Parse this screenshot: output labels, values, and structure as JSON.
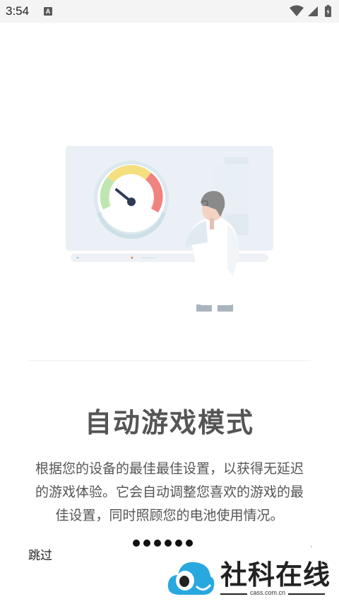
{
  "status_bar": {
    "time": "3:54",
    "notification_icon": "A"
  },
  "onboarding": {
    "title": "自动游戏模式",
    "description_lines": [
      "根据您的设备的最佳最佳设置，以获得无延迟",
      "的游戏体验。它会自动调整您喜欢的游戏的最",
      "佳设置，同时照顾您的电池使用情况。"
    ],
    "skip_label": "跳过",
    "page_count": 6,
    "illustration": "speedometer-with-scientist"
  },
  "watermark": {
    "name": "社科在线",
    "site": "cass.com.cn"
  },
  "colors": {
    "title": "#555555",
    "text": "#555555",
    "gauge_red": "#f0837f",
    "gauge_yellow": "#f4df7e",
    "gauge_green": "#bfe6b0",
    "watermark_blue": "#29a8e0"
  }
}
